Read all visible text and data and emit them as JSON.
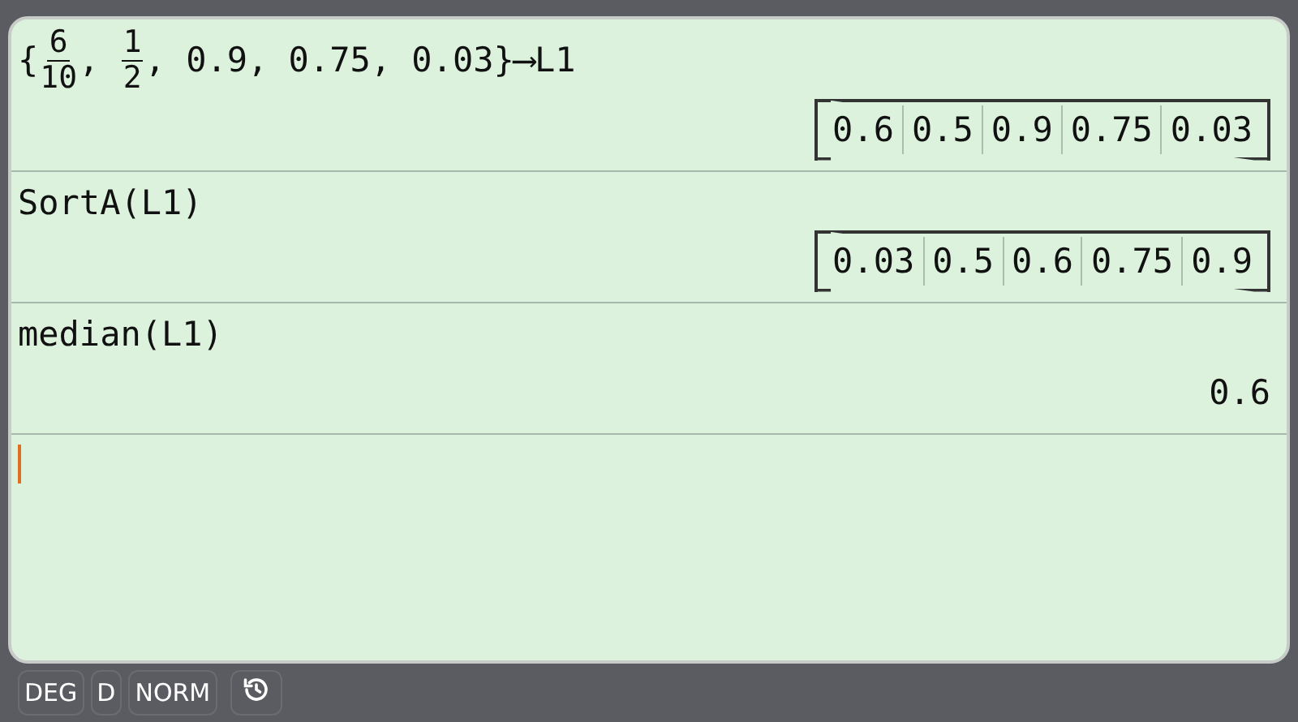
{
  "history": [
    {
      "input": [
        {
          "kind": "text",
          "text": "{"
        },
        {
          "kind": "frac",
          "num": "6",
          "den": "10"
        },
        {
          "kind": "text",
          "text": ", "
        },
        {
          "kind": "frac",
          "num": "1",
          "den": "2"
        },
        {
          "kind": "text",
          "text": ", 0.9, 0.75, 0.03}⟶L1"
        }
      ],
      "result": {
        "kind": "matrix",
        "cells": [
          "0.6",
          "0.5",
          "0.9",
          "0.75",
          "0.03"
        ]
      }
    },
    {
      "input": [
        {
          "kind": "text",
          "text": "SortA(L1)"
        }
      ],
      "result": {
        "kind": "matrix",
        "cells": [
          "0.03",
          "0.5",
          "0.6",
          "0.75",
          "0.9"
        ]
      }
    },
    {
      "input": [
        {
          "kind": "text",
          "text": "median(L1)"
        }
      ],
      "result": {
        "kind": "value",
        "text": "0.6"
      }
    }
  ],
  "status_bar": [
    {
      "kind": "text",
      "label": "DEG"
    },
    {
      "kind": "text",
      "label": "D"
    },
    {
      "kind": "text",
      "label": "NORM"
    },
    {
      "kind": "history"
    }
  ]
}
